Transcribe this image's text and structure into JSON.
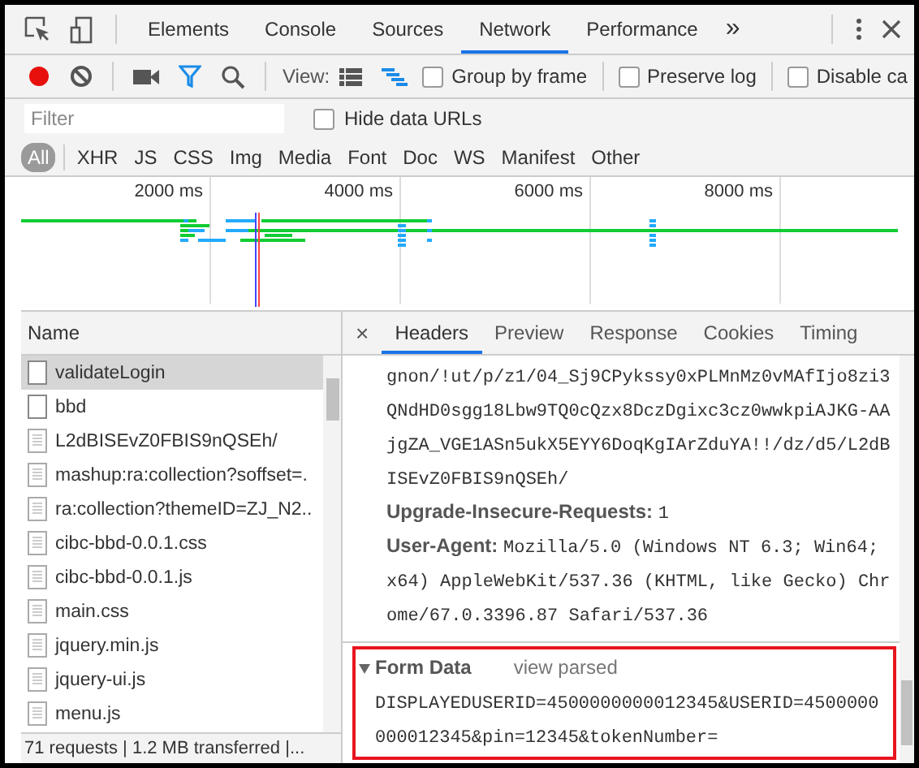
{
  "panel_tabs": [
    {
      "label": "Elements",
      "selected": false
    },
    {
      "label": "Console",
      "selected": false
    },
    {
      "label": "Sources",
      "selected": false
    },
    {
      "label": "Network",
      "selected": true
    },
    {
      "label": "Performance",
      "selected": false
    }
  ],
  "more_tabs": "»",
  "toolbar": {
    "recording": true,
    "filter_active": true,
    "view_label": "View:",
    "waterfall_view": true,
    "options": [
      {
        "label": "Group by frame",
        "checked": false
      },
      {
        "label": "Preserve log",
        "checked": false
      },
      {
        "label": "Disable ca",
        "checked": false
      }
    ]
  },
  "filter": {
    "placeholder": "Filter",
    "hide_data_urls": {
      "label": "Hide data URLs",
      "checked": false
    }
  },
  "type_filters": [
    {
      "label": "All",
      "selected": true
    },
    {
      "label": "XHR",
      "selected": false
    },
    {
      "label": "JS",
      "selected": false
    },
    {
      "label": "CSS",
      "selected": false
    },
    {
      "label": "Img",
      "selected": false
    },
    {
      "label": "Media",
      "selected": false
    },
    {
      "label": "Font",
      "selected": false
    },
    {
      "label": "Doc",
      "selected": false
    },
    {
      "label": "WS",
      "selected": false
    },
    {
      "label": "Manifest",
      "selected": false
    },
    {
      "label": "Other",
      "selected": false
    }
  ],
  "overview": {
    "ticks": [
      "2000 ms",
      "4000 ms",
      "6000 ms",
      "8000 ms"
    ]
  },
  "requests": {
    "column": "Name",
    "rows": [
      {
        "name": "validateLogin",
        "kind": "blank",
        "selected": true
      },
      {
        "name": "bbd",
        "kind": "blank",
        "selected": false
      },
      {
        "name": "L2dBISEvZ0FBIS9nQSEh/",
        "kind": "file",
        "selected": false
      },
      {
        "name": "mashup:ra:collection?soffset=.",
        "kind": "file",
        "selected": false
      },
      {
        "name": "ra:collection?themeID=ZJ_N2..",
        "kind": "file",
        "selected": false
      },
      {
        "name": "cibc-bbd-0.0.1.css",
        "kind": "file",
        "selected": false
      },
      {
        "name": "cibc-bbd-0.0.1.js",
        "kind": "file",
        "selected": false
      },
      {
        "name": "main.css",
        "kind": "file",
        "selected": false
      },
      {
        "name": "jquery.min.js",
        "kind": "file",
        "selected": false
      },
      {
        "name": "jquery-ui.js",
        "kind": "file",
        "selected": false
      },
      {
        "name": "menu.js",
        "kind": "file",
        "selected": false
      }
    ]
  },
  "status_bar": "71 requests | 1.2 MB transferred |...",
  "details": {
    "close": "×",
    "tabs": [
      {
        "label": "Headers",
        "selected": true
      },
      {
        "label": "Preview",
        "selected": false
      },
      {
        "label": "Response",
        "selected": false
      },
      {
        "label": "Cookies",
        "selected": false
      },
      {
        "label": "Timing",
        "selected": false
      }
    ],
    "lines": [
      {
        "kind": "text",
        "text": "gnon/!ut/p/z1/04_Sj9CPykssy0xPLMnMz0vMAfIjo8zi3"
      },
      {
        "kind": "text",
        "text": "QNdHD0sgg18Lbw9TQ0cQzx8DczDgixc3cz0wwkpiAJKG-AA"
      },
      {
        "kind": "text",
        "text": "jgZA_VGE1ASn5ukX5EYY6DoqKgIArZduYA!!/dz/d5/L2dB"
      },
      {
        "kind": "text",
        "text": "ISEvZ0FBIS9nQSEh/"
      },
      {
        "kind": "header",
        "name": "Upgrade-Insecure-Requests:",
        "value": "1"
      },
      {
        "kind": "header",
        "name": "User-Agent:",
        "value": "Mozilla/5.0 (Windows NT 6.3; Win64;"
      },
      {
        "kind": "text",
        "text": "x64) AppleWebKit/537.36 (KHTML, like Gecko) Chr"
      },
      {
        "kind": "text",
        "text": "ome/67.0.3396.87 Safari/537.36"
      }
    ],
    "form_data": {
      "title": "Form Data",
      "link": "view parsed",
      "expanded": true,
      "highlighted": true,
      "lines": [
        "DISPLAYEDUSERID=4500000000012345&USERID=4500000",
        "000012345&pin=12345&tokenNumber="
      ]
    }
  }
}
